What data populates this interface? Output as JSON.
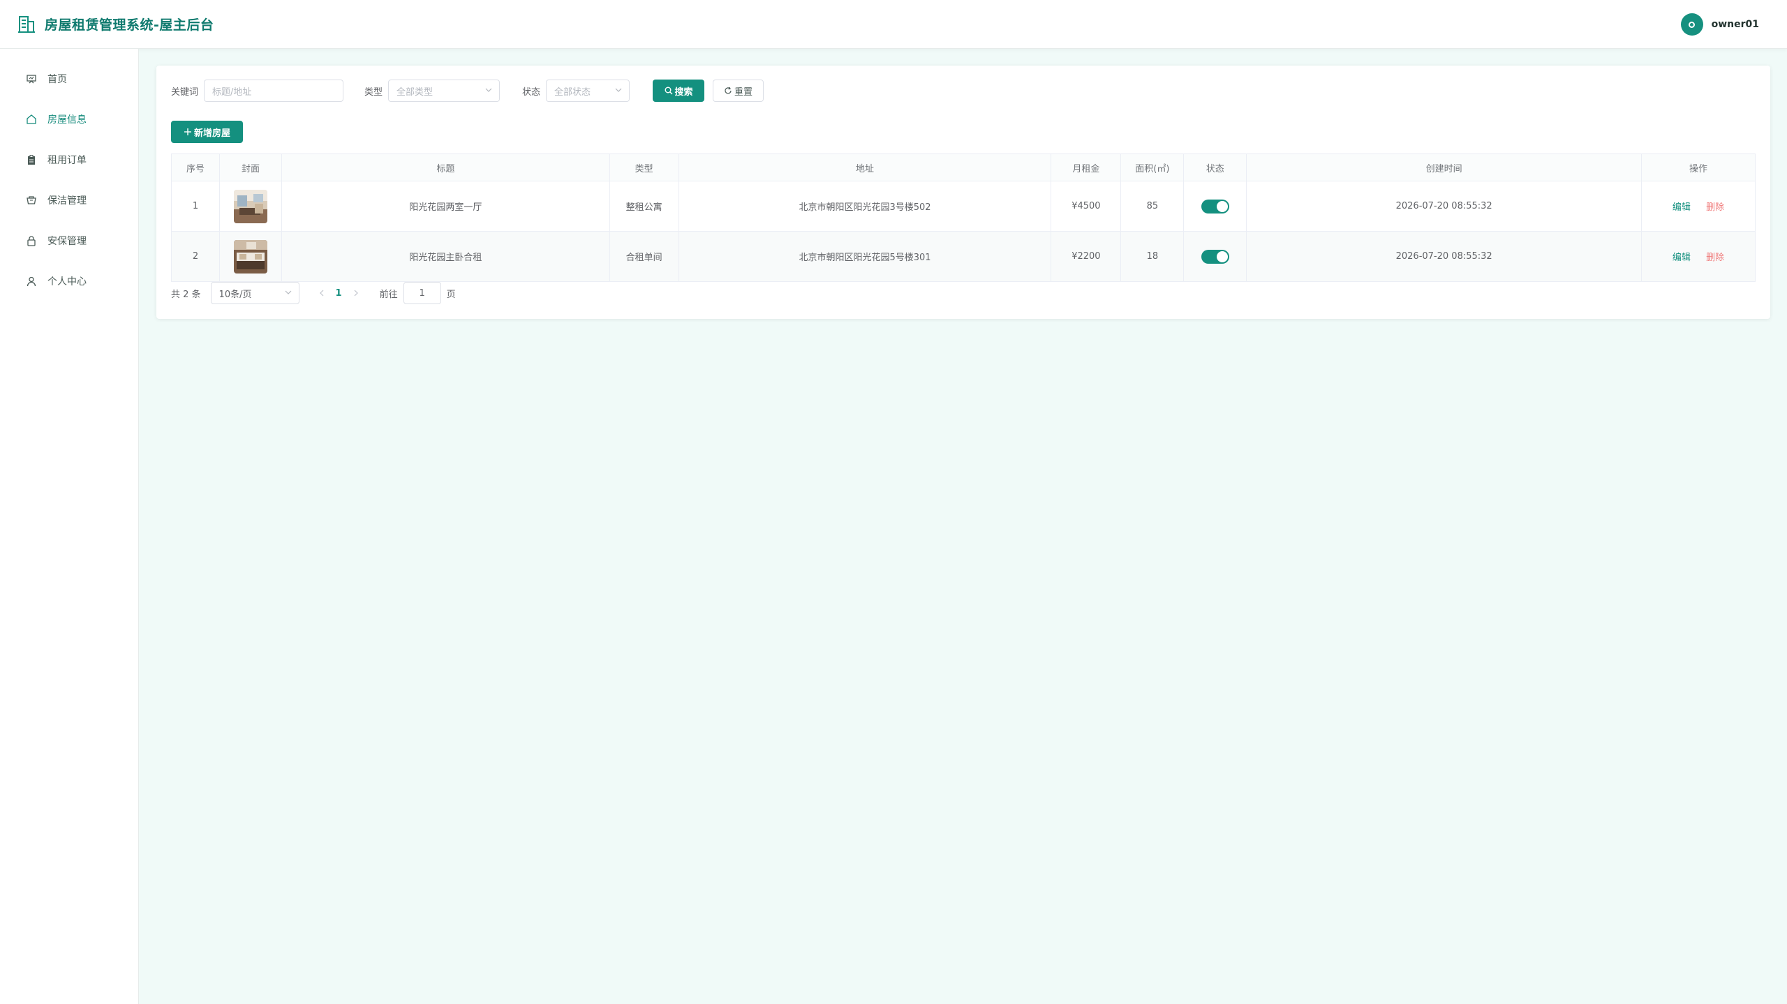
{
  "header": {
    "title": "房屋租赁管理系统-屋主后台",
    "user": "owner01"
  },
  "sidebar": {
    "items": [
      {
        "label": "首页",
        "icon": "monitor-icon"
      },
      {
        "label": "房屋信息",
        "icon": "home-icon"
      },
      {
        "label": "租用订单",
        "icon": "clipboard-icon"
      },
      {
        "label": "保洁管理",
        "icon": "basket-icon"
      },
      {
        "label": "安保管理",
        "icon": "lock-icon"
      },
      {
        "label": "个人中心",
        "icon": "user-icon"
      }
    ],
    "active": "房屋信息"
  },
  "filters": {
    "keyword_label": "关键词",
    "keyword_placeholder": "标题/地址",
    "type_label": "类型",
    "type_value": "全部类型",
    "status_label": "状态",
    "status_value": "全部状态",
    "search_label": "搜索",
    "reset_label": "重置"
  },
  "add_button": "新增房屋",
  "table": {
    "columns": [
      "序号",
      "封面",
      "标题",
      "类型",
      "地址",
      "月租金",
      "面积(㎡)",
      "状态",
      "创建时间",
      "操作"
    ],
    "rows": [
      {
        "index": "1",
        "title": "阳光花园两室一厅",
        "type": "整租公寓",
        "address": "北京市朝阳区阳光花园3号楼502",
        "rent": "¥4500",
        "area": "85",
        "status_on": true,
        "created": "2026-07-20 08:55:32"
      },
      {
        "index": "2",
        "title": "阳光花园主卧合租",
        "type": "合租单间",
        "address": "北京市朝阳区阳光花园5号楼301",
        "rent": "¥2200",
        "area": "18",
        "status_on": true,
        "created": "2026-07-20 08:55:32"
      }
    ],
    "edit_label": "编辑",
    "delete_label": "删除"
  },
  "pagination": {
    "total": "共 2 条",
    "page_size": "10条/页",
    "current_page": "1",
    "goto_label": "前往",
    "goto_value": "1",
    "page_suffix": "页"
  },
  "colors": {
    "primary": "#14907f",
    "danger": "#f07b7b",
    "background": "#f0faf8"
  }
}
